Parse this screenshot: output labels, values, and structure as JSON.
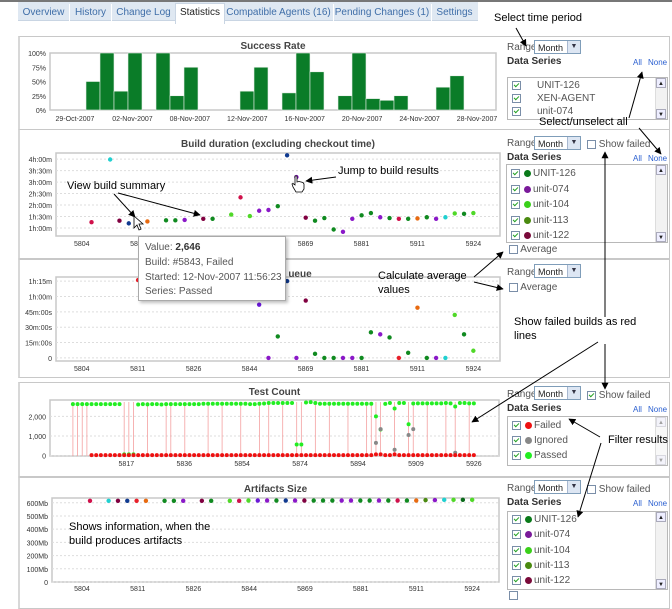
{
  "tabs": [
    {
      "label": "Overview",
      "active": false
    },
    {
      "label": "History",
      "active": false
    },
    {
      "label": "Change Log",
      "active": false
    },
    {
      "label": "Statistics",
      "active": true
    },
    {
      "label": "Compatible Agents (16)",
      "active": false
    },
    {
      "label": "Pending Changes (1)",
      "active": false
    },
    {
      "label": "Settings",
      "active": false
    }
  ],
  "common": {
    "range_label": "Range",
    "range_value": "Month",
    "data_series_label": "Data Series",
    "all_label": "All",
    "none_label": "None",
    "show_failed_label": "Show failed",
    "average_label": "Average"
  },
  "panels": {
    "success_rate": {
      "series": [
        {
          "label": "UNIT-126",
          "checked": true
        },
        {
          "label": "XEN-AGENT",
          "checked": true
        },
        {
          "label": "unit-074",
          "checked": true
        }
      ]
    },
    "build_duration": {
      "show_failed": false,
      "average": false,
      "series": [
        {
          "label": "UNIT-126",
          "color": "#0a7a1a",
          "checked": true
        },
        {
          "label": "unit-074",
          "color": "#7a1a9a",
          "checked": true
        },
        {
          "label": "unit-104",
          "color": "#3ad01a",
          "checked": true
        },
        {
          "label": "unit-113",
          "color": "#4a8a10",
          "checked": true
        },
        {
          "label": "unit-122",
          "color": "#7a0a3a",
          "checked": true
        }
      ]
    },
    "queue": {
      "average": false
    },
    "test_count": {
      "show_failed": true,
      "series": [
        {
          "label": "Failed",
          "color": "#ee1111",
          "checked": true
        },
        {
          "label": "Ignored",
          "color": "#888888",
          "checked": true
        },
        {
          "label": "Passed",
          "color": "#22ee22",
          "checked": true
        }
      ]
    },
    "artifacts": {
      "show_failed": false,
      "series": [
        {
          "label": "UNIT-126",
          "color": "#0a7a1a",
          "checked": true
        },
        {
          "label": "unit-074",
          "color": "#7a1a9a",
          "checked": true
        },
        {
          "label": "unit-104",
          "color": "#3ad01a",
          "checked": true
        },
        {
          "label": "unit-113",
          "color": "#4a8a10",
          "checked": true
        },
        {
          "label": "unit-122",
          "color": "#7a0a3a",
          "checked": true
        }
      ]
    }
  },
  "tooltip": {
    "value_label": "Value: ",
    "value": "2,646",
    "build": "Build:  #5843, Failed",
    "started": "Started: 12-Nov-2007 11:56:23",
    "series": "Series: Passed"
  },
  "annotations": {
    "select_time_period": "Select time period",
    "select_unselect_all": "Select/unselect all",
    "view_build_summary": "View build summary",
    "jump_to_build_results": "Jump to build results",
    "calculate_average_1": "Calculate average",
    "calculate_average_2": "values",
    "show_failed_1": "Show  failed builds as red",
    "show_failed_2": "lines",
    "filter_results": "Filter results",
    "artifacts_info_1": "Shows information, when the",
    "artifacts_info_2": "build produces artifacts"
  },
  "chart_data": [
    {
      "type": "bar",
      "title": "Success Rate",
      "categories_tick_labels": [
        "29-Oct-2007",
        "02-Nov-2007",
        "08-Nov-2007",
        "12-Nov-2007",
        "16-Nov-2007",
        "20-Nov-2007",
        "24-Nov-2007",
        "28-Nov-2007"
      ],
      "values": [
        null,
        null,
        50,
        100,
        33,
        100,
        null,
        100,
        25,
        75,
        null,
        null,
        null,
        33,
        75,
        null,
        30,
        100,
        67,
        null,
        25,
        100,
        20,
        17,
        25,
        null,
        null,
        40,
        60,
        null,
        null
      ],
      "ylim": [
        0,
        100
      ],
      "yticks": [
        {
          "label": "0%",
          "v": 0
        },
        {
          "label": "25%",
          "v": 25
        },
        {
          "label": "50%",
          "v": 50
        },
        {
          "label": "75%",
          "v": 75
        },
        {
          "label": "100%",
          "v": 100
        }
      ],
      "bar_color": "#0a7c28",
      "grid": false
    },
    {
      "type": "scatter",
      "title": "Build duration (excluding checkout time)",
      "y_unit": "minutes",
      "ylim": [
        39,
        256
      ],
      "yticks": [
        {
          "label": "1h:00m",
          "v": 60
        },
        {
          "label": "1h:30m",
          "v": 90
        },
        {
          "label": "2h:00m",
          "v": 120
        },
        {
          "label": "2h:30m",
          "v": 150
        },
        {
          "label": "3h:00m",
          "v": 180
        },
        {
          "label": "3h:30m",
          "v": 210
        },
        {
          "label": "4h:00m",
          "v": 240
        }
      ],
      "xticks": [
        "5804",
        "5811",
        "5826",
        "5844",
        "5869",
        "5881",
        "5911",
        "5924"
      ],
      "values": [
        75,
        null,
        239,
        79,
        72,
        75,
        77,
        null,
        80,
        80,
        81,
        null,
        84,
        84,
        null,
        95,
        140,
        91,
        105,
        107,
        117,
        250,
        193,
        87,
        79,
        86,
        56,
        50,
        84,
        93,
        99,
        88,
        86,
        84,
        84,
        85,
        88,
        84,
        88,
        98,
        97,
        99
      ],
      "colors": [
        "#d0104a",
        null,
        "#20d0d0",
        "#800040",
        "#103a90",
        "#e8202a",
        "#e86a10",
        null,
        "#108a20",
        "#108a20",
        "#8a18c8",
        null,
        "#800040",
        "#108a20",
        null,
        "#50d828",
        "#d0104a",
        "#50d828",
        "#8a18c8",
        "#8a18c8",
        "#108a20",
        "#103a90",
        "#8a18c8",
        "#800040",
        "#108a20",
        "#108a20",
        "#108a20",
        "#8a18c8",
        "#8a18c8",
        "#108a20",
        "#108a20",
        "#8a18c8",
        "#108a20",
        "#d0104a",
        "#108a20",
        "#e86a10",
        "#108a20",
        "#8a18c8",
        "#20d0d0",
        "#50d828",
        "#108a20",
        "#50d828"
      ],
      "grid": true
    },
    {
      "type": "scatter",
      "title": "ueue",
      "y_unit": "minutes",
      "ylim": [
        -3,
        79
      ],
      "yticks": [
        {
          "label": "0",
          "v": 0
        },
        {
          "label": "15m:00s",
          "v": 15
        },
        {
          "label": "30m:00s",
          "v": 30
        },
        {
          "label": "45m:00s",
          "v": 45
        },
        {
          "label": "1h:00m",
          "v": 60
        },
        {
          "label": "1h:15m",
          "v": 75
        }
      ],
      "xticks": [
        "5804",
        "5811",
        "5826",
        "5844",
        "5869",
        "5881",
        "5911",
        "5924"
      ],
      "values": [
        null,
        null,
        null,
        null,
        null,
        76,
        null,
        null,
        null,
        null,
        null,
        null,
        null,
        null,
        null,
        null,
        null,
        null,
        52,
        0,
        21,
        75,
        0,
        56,
        4,
        0,
        0,
        0,
        0,
        0,
        25,
        23,
        20,
        0,
        5,
        49,
        0,
        0,
        0,
        42,
        23,
        7
      ],
      "colors": [
        null,
        null,
        null,
        null,
        null,
        "#e8202a",
        null,
        null,
        null,
        null,
        null,
        null,
        null,
        null,
        null,
        null,
        null,
        null,
        "#6a18d8",
        "#8a18c8",
        "#108a20",
        "#103a90",
        "#8a18c8",
        "#800040",
        "#108a20",
        "#108a20",
        "#108a20",
        "#8a18c8",
        "#8a18c8",
        "#108a20",
        "#108a20",
        "#8a18c8",
        "#108a20",
        "#e8202a",
        "#108a20",
        "#e86a10",
        "#108a20",
        "#8a18c8",
        "#20d0d0",
        "#50d828",
        "#108a20",
        "#50d828"
      ],
      "grid": true
    },
    {
      "type": "scatter",
      "title": "Test Count",
      "ylim": [
        -15,
        2830
      ],
      "yticks": [
        {
          "label": "0",
          "v": 0
        },
        {
          "label": "1,000",
          "v": 1000
        },
        {
          "label": "2,000",
          "v": 2000
        }
      ],
      "xticks": [
        "5817",
        "5836",
        "5854",
        "5874",
        "5894",
        "5909",
        "5926"
      ],
      "series": [
        {
          "name": "Passed",
          "color": "#22ee22",
          "values": [
            2620,
            2620,
            2620,
            2620,
            2620,
            2620,
            2620,
            2620,
            2620,
            2620,
            2620,
            70,
            70,
            70,
            2600,
            2620,
            2610,
            2620,
            2620,
            2600,
            2620,
            2620,
            2620,
            2620,
            2620,
            2620,
            2620,
            2620,
            2640,
            2640,
            2640,
            2640,
            2640,
            2640,
            2640,
            2640,
            2640,
            2640,
            2620,
            2620,
            2640,
            2650,
            2680,
            2680,
            2680,
            2680,
            2680,
            2680,
            570,
            570,
            2700,
            2720,
            2680,
            2640,
            2640,
            2640,
            2640,
            2640,
            2640,
            2640,
            2640,
            2640,
            2640,
            2640,
            2640,
            2000,
            1330,
            2630,
            2680,
            2400,
            2680,
            2680,
            1600,
            2650,
            2660,
            2660,
            2660,
            2660,
            2660,
            2660,
            2680,
            2660,
            2500,
            2680,
            2680,
            2660,
            2660
          ]
        },
        {
          "name": "Ignored",
          "color": "#888888",
          "values": [
            null,
            null,
            null,
            null,
            null,
            null,
            null,
            null,
            null,
            null,
            null,
            null,
            null,
            null,
            null,
            null,
            null,
            null,
            null,
            null,
            null,
            null,
            null,
            null,
            null,
            null,
            null,
            null,
            null,
            null,
            null,
            null,
            null,
            null,
            null,
            null,
            null,
            null,
            null,
            null,
            null,
            null,
            null,
            null,
            null,
            null,
            null,
            null,
            null,
            null,
            null,
            null,
            null,
            null,
            null,
            null,
            null,
            null,
            null,
            null,
            null,
            null,
            null,
            null,
            null,
            650,
            1350,
            null,
            null,
            300,
            null,
            null,
            1050,
            1350,
            null,
            null,
            null,
            null,
            null,
            null,
            null,
            null,
            150,
            null,
            null,
            null,
            null
          ]
        },
        {
          "name": "Failed",
          "color": "#ee1111",
          "values": [
            null,
            null,
            null,
            null,
            30,
            30,
            30,
            30,
            30,
            30,
            30,
            30,
            30,
            30,
            30,
            30,
            30,
            30,
            30,
            30,
            30,
            30,
            30,
            30,
            30,
            30,
            30,
            30,
            30,
            30,
            30,
            30,
            30,
            30,
            30,
            30,
            30,
            30,
            30,
            30,
            30,
            30,
            30,
            30,
            30,
            30,
            30,
            30,
            30,
            30,
            30,
            30,
            30,
            30,
            30,
            30,
            30,
            30,
            30,
            30,
            30,
            30,
            30,
            30,
            30,
            70,
            70,
            30,
            30,
            70,
            30,
            30,
            30,
            30,
            30,
            30,
            30,
            30,
            30,
            30,
            30,
            30,
            30,
            30,
            30,
            30,
            30
          ]
        }
      ],
      "failed_build_indices": [
        0,
        1,
        2,
        3,
        11,
        12,
        13,
        16,
        20,
        21,
        24,
        29,
        32,
        36,
        40,
        42,
        45,
        48,
        49,
        52,
        55,
        59,
        63,
        64,
        65,
        66,
        69,
        72,
        73,
        76,
        80,
        82,
        85
      ],
      "failed_line_color": "#f4a0a0",
      "grid": true
    },
    {
      "type": "scatter",
      "title": "Artifacts Size",
      "y_unit": "Mb",
      "ylim": [
        0,
        636
      ],
      "yticks": [
        {
          "label": "0",
          "v": 0
        },
        {
          "label": "100Mb",
          "v": 100
        },
        {
          "label": "200Mb",
          "v": 200
        },
        {
          "label": "300Mb",
          "v": 300
        },
        {
          "label": "400Mb",
          "v": 400
        },
        {
          "label": "500Mb",
          "v": 500
        },
        {
          "label": "600Mb",
          "v": 600
        }
      ],
      "xticks": [
        "5804",
        "5811",
        "5826",
        "5844",
        "5869",
        "5881",
        "5911",
        "5924"
      ],
      "values": [
        615,
        null,
        615,
        615,
        615,
        615,
        615,
        null,
        615,
        615,
        615,
        null,
        615,
        615,
        null,
        615,
        615,
        617,
        617,
        617,
        617,
        617,
        617,
        617,
        617,
        617,
        617,
        617,
        617,
        617,
        617,
        617,
        617,
        617,
        617,
        617,
        620,
        620,
        622,
        622,
        622,
        622
      ],
      "colors": [
        "#d0104a",
        null,
        "#20d0d0",
        "#800040",
        "#103a90",
        "#e8202a",
        "#e86a10",
        null,
        "#108a20",
        "#108a20",
        "#8a18c8",
        null,
        "#800040",
        "#108a20",
        null,
        "#50d828",
        "#d0104a",
        "#50d828",
        "#6a18d8",
        "#8a18c8",
        "#108a20",
        "#103a90",
        "#8a18c8",
        "#800040",
        "#108a20",
        "#108a20",
        "#108a20",
        "#8a18c8",
        "#8a18c8",
        "#108a20",
        "#108a20",
        "#8a18c8",
        "#108a20",
        "#d0104a",
        "#108a20",
        "#e86a10",
        "#4a8a10",
        "#8a18c8",
        "#20d0d0",
        "#50d828",
        "#0a6a1a",
        "#50d828"
      ],
      "grid": true
    }
  ]
}
